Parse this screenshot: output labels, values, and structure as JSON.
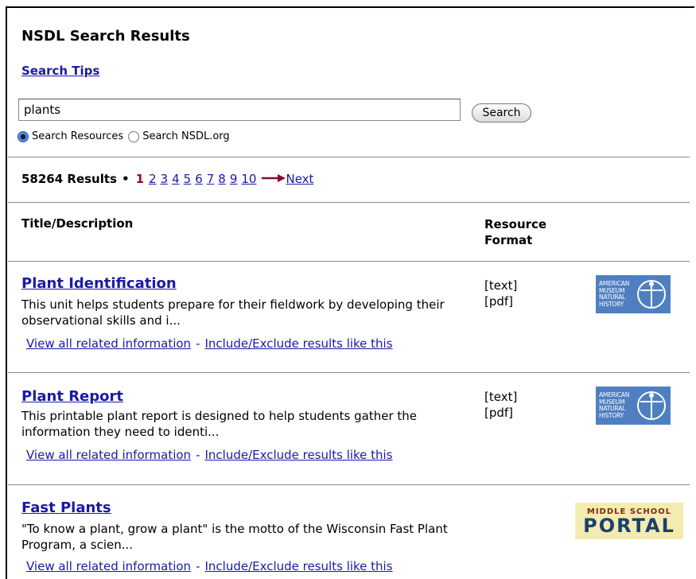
{
  "page": {
    "title": "NSDL Search Results",
    "search_tips": "Search Tips"
  },
  "search": {
    "query": "plants",
    "button_label": "Search",
    "options": [
      {
        "label": "Search Resources",
        "selected": true
      },
      {
        "label": "Search NSDL.org",
        "selected": false
      }
    ]
  },
  "pagination": {
    "count_text": "58264 Results",
    "bullet": "•",
    "current": "1",
    "pages": [
      "2",
      "3",
      "4",
      "5",
      "6",
      "7",
      "8",
      "9",
      "10"
    ],
    "next_label": "Next"
  },
  "columns": {
    "title": "Title/Description",
    "format_line1": "Resource",
    "format_line2": "Format"
  },
  "results": [
    {
      "title": "Plant Identification",
      "description": "This unit helps students prepare for their fieldwork by developing their observational skills and i...",
      "formats": [
        "[text]",
        "[pdf]"
      ],
      "logo": "AMERICAN MUSEUM NATURAL HISTORY",
      "link_related": "View all related information",
      "link_sep": "-",
      "link_include": "Include/Exclude results like this"
    },
    {
      "title": "Plant Report",
      "description": "This printable plant report is designed to help students gather the information they need to identi...",
      "formats": [
        "[text]",
        "[pdf]"
      ],
      "logo": "AMERICAN MUSEUM NATURAL HISTORY",
      "link_related": "View all related information",
      "link_sep": "-",
      "link_include": "Include/Exclude results like this"
    },
    {
      "title": "Fast Plants",
      "description": "\"To know a plant, grow a plant\" is the motto of the Wisconsin Fast Plant Program, a scien...",
      "formats": [],
      "logo_small": "MIDDLE SCHOOL",
      "logo_big": "PORTAL",
      "link_related": "View all related information",
      "link_sep": "-",
      "link_include": "Include/Exclude results like this"
    }
  ],
  "colors": {
    "link": "#1a1aa6",
    "current_page": "#8b0a2a",
    "amnh_logo_bg": "#4f7fc0",
    "msp_logo_bg": "#f3ecb0"
  }
}
